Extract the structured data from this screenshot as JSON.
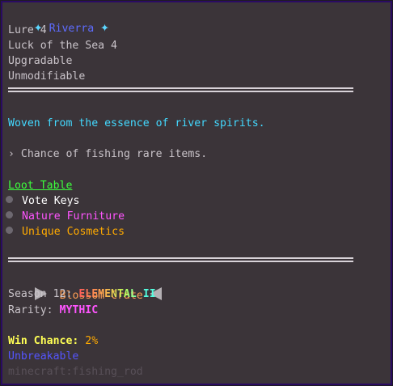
{
  "tooltip": {
    "title": "Riverra",
    "title_star": "✦",
    "enchantments": [
      "Lure 4",
      "Luck of the Sea 4"
    ],
    "flags": [
      "Upgradable",
      "Unmodifiable"
    ],
    "description": "Woven from the essence of river spirits.",
    "ability_prefix": "›",
    "ability": "Chance of fishing rare items.",
    "loot_table": {
      "heading": "Loot Table",
      "items": [
        {
          "label": "Vote Keys",
          "color": "#ffffff"
        },
        {
          "label": "Nature Furniture",
          "color": "#ff55ff"
        },
        {
          "label": "Unique Cosmetics",
          "color": "#ffaa00"
        }
      ]
    },
    "crate": "Blossom Crate",
    "season_label": "Season 12:",
    "season_value": "ELEMENTAL II",
    "rarity_label": "Rarity:",
    "rarity_value": "MYTHIC",
    "win_label": "Win Chance:",
    "win_value": "2%",
    "unbreakable": "Unbreakable",
    "item_id": "minecraft:fishing_rod",
    "colors": {
      "background": "#3b3439",
      "border": "#2a0a63",
      "title": "#5e6cff",
      "description": "#43d9ff",
      "loot_heading": "#3dff3d",
      "rarity": "#ff55ff"
    }
  }
}
